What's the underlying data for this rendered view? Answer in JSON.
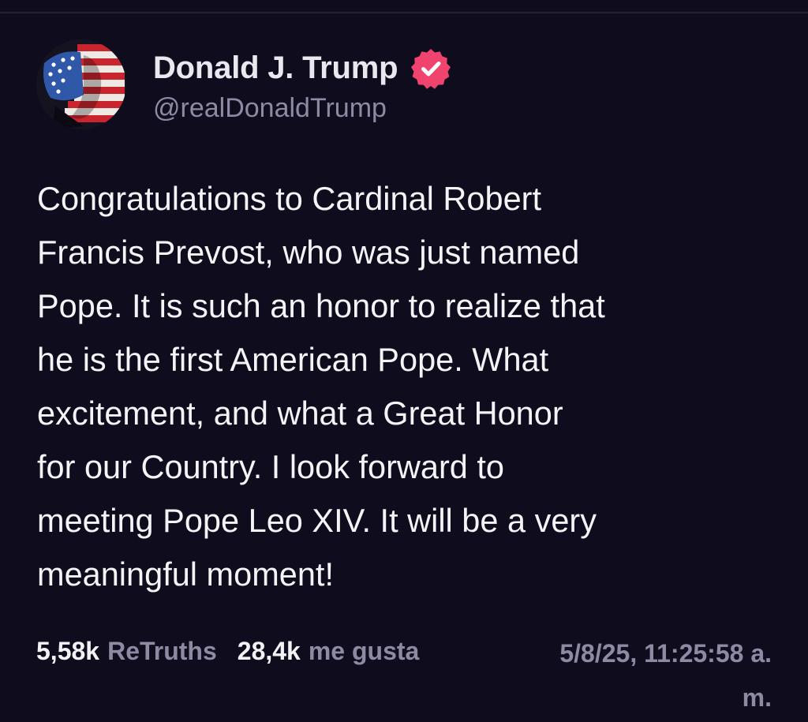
{
  "post": {
    "author": {
      "display_name": "Donald J. Trump",
      "handle": "@realDonaldTrump",
      "verified": true,
      "avatar_icon": "flag-portrait-avatar"
    },
    "text": "Congratulations to Cardinal Robert\nFrancis Prevost, who was just named\nPope. It is such an honor to realize that\nhe is the first American Pope. What\nexcitement, and what a Great Honor\nfor our Country. I look forward to\nmeeting Pope Leo XIV. It will be a very\nmeaningful moment!",
    "stats": {
      "retruths_count": "5,58k",
      "retruths_label": "ReTruths",
      "likes_count": "28,4k",
      "likes_label": "me gusta"
    },
    "timestamp": "5/8/25, 11:25:58 a. m."
  },
  "colors": {
    "background": "#0f0c1e",
    "verified_badge": "#f0436e",
    "muted_text": "#8e8aa3",
    "primary_text": "#f4f4f7"
  }
}
